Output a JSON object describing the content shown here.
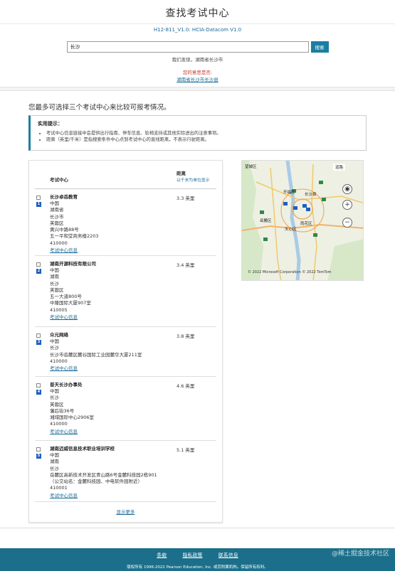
{
  "header": {
    "title": "查找考试中心"
  },
  "exam": {
    "code": "H12-811_V1.0: HCIA-Datacom V1.0"
  },
  "search": {
    "value": "长沙",
    "button": "搜索",
    "detected": "我们发现，湖南省长沙市",
    "intent_label": "您的意思是否:",
    "intent_link": "湖南省长沙市长沙县"
  },
  "compare_note": "您最多可选择三个考试中心来比较可报考情况。",
  "tips": {
    "title": "实用提示：",
    "items": [
      "考试中心信息链接中会提供出行指南、停车信息、轮椅支持或其他实际进出的注意事项。",
      "距离（英里/千米）是指搜索条件中心点到考试中心的直线距离，不表示行驶距离。"
    ]
  },
  "table": {
    "col_center": "考试中心",
    "col_distance": "距离",
    "unit_link": "以千米为单位显示"
  },
  "centers": [
    {
      "name": "长沙卓岳教育",
      "lines": [
        "中国",
        "湖南省",
        "长沙市",
        "芙蓉区",
        "黄兴中路88号",
        "五一平和堂商务楼2203",
        "410000"
      ],
      "link": "考试中心信息",
      "distance": "3.3 英里"
    },
    {
      "name": "湖南开源科技有限公司",
      "lines": [
        "中国",
        "湖南",
        "长沙",
        "芙蓉区",
        "五一大道800号",
        "中隆国际大厦907室",
        "410005"
      ],
      "link": "考试中心信息",
      "distance": "3.4 英里"
    },
    {
      "name": "众元网络",
      "lines": [
        "中国",
        "长沙",
        "长沙市岳麓区麓谷国际工业园麓华大厦211室",
        "410000"
      ],
      "link": "考试中心信息",
      "distance": "3.8 英里"
    },
    {
      "name": "普天长沙办事处",
      "lines": [
        "中国",
        "长沙",
        "芙蓉区",
        "藩后街36号",
        "湘域国际中心2906室",
        "410000"
      ],
      "link": "考试中心信息",
      "distance": "4.6 英里"
    },
    {
      "name": "湖南迈威信息技术职业培训学校",
      "lines": [
        "中国",
        "湖南",
        "长沙",
        "岳麓区高新技术开发区青山路6号金麓科技园2栋901",
        "（公交站名：金麓科技园、中电软件园附近）",
        "410001"
      ],
      "link": "考试中心信息",
      "distance": "5.1 英里"
    }
  ],
  "show_more": "显示更多",
  "map": {
    "labels": [
      "望城区",
      "道路",
      "开福区",
      "长沙县",
      "岳麓区",
      "雨花区",
      "天心区"
    ],
    "zoom_in": "+",
    "zoom_out": "−",
    "copyright": "© 2022 Microsoft Corporation  © 2022 TomTom"
  },
  "footer": {
    "links": [
      "条款",
      "隐私政策",
      "联系信息"
    ],
    "copyright": "版权所有 1996-2022 Pearson Education, Inc. 或其附属机构。保留所有权利。",
    "watermark": "@稀土掘金技术社区"
  },
  "colors": {
    "accent": "#1b7ea0",
    "footer": "#1b6f8a",
    "link": "#1a6a9a",
    "warning": "#c0392b"
  }
}
